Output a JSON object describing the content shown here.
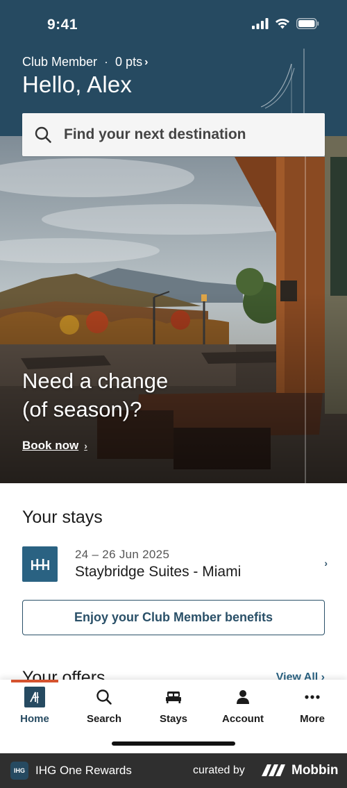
{
  "status_bar": {
    "time": "9:41",
    "icons": [
      "signal-icon",
      "wifi-icon",
      "battery-icon"
    ]
  },
  "header": {
    "membership_tier": "Club Member",
    "separator": "·",
    "points": "0 pts",
    "points_chevron": "›",
    "greeting": "Hello, Alex",
    "background_color": "#264a61"
  },
  "search": {
    "placeholder": "Find your next destination",
    "icon": "search-icon"
  },
  "hero": {
    "headline_line1": "Need a change",
    "headline_line2": "(of season)?",
    "cta": "Book now",
    "cta_chevron": "›"
  },
  "stays": {
    "title": "Your stays",
    "items": [
      {
        "dates": "24 – 26 Jun 2025",
        "hotel": "Staybridge Suites - Miami",
        "chevron": "›",
        "logo_icon": "staybridge-logo-icon"
      }
    ],
    "benefits_button": "Enjoy your Club Member benefits"
  },
  "offers": {
    "title": "Your offers",
    "view_all": "View All ›"
  },
  "tab_bar": {
    "active_tab": "Home",
    "indicator_color": "#d5532f",
    "tabs": [
      {
        "label": "Home",
        "icon": "ihg-home-icon"
      },
      {
        "label": "Search",
        "icon": "search-icon"
      },
      {
        "label": "Stays",
        "icon": "bed-icon"
      },
      {
        "label": "Account",
        "icon": "person-icon"
      },
      {
        "label": "More",
        "icon": "more-dots-icon"
      }
    ]
  },
  "footer": {
    "badge": "IHG",
    "app_name": "IHG One Rewards",
    "curated_by": "curated by",
    "brand": "Mobbin"
  },
  "colors": {
    "brand_navy": "#264a61",
    "accent_blue": "#2a6282",
    "accent_orange": "#d5532f"
  }
}
